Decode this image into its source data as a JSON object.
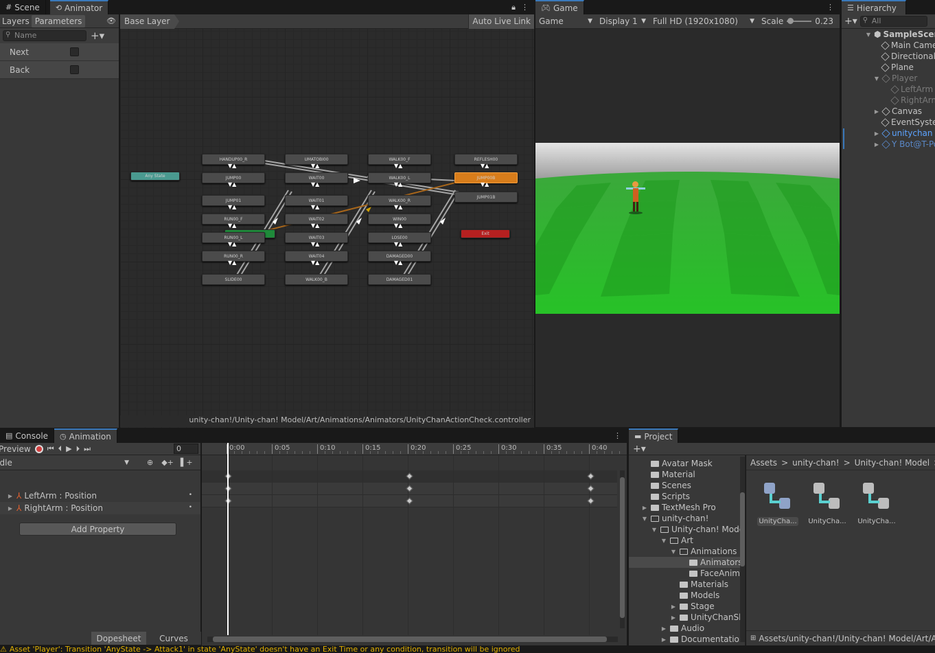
{
  "animator_tabs": {
    "scene": "Scene",
    "animator": "Animator"
  },
  "animator": {
    "layers_tab": "Layers",
    "parameters_tab": "Parameters",
    "search_placeholder": "Name",
    "params": [
      {
        "name": "Next"
      },
      {
        "name": "Back"
      }
    ],
    "breadcrumb": "Base Layer",
    "auto_live_link": "Auto Live Link",
    "path": "unity-chan!/Unity-chan! Model/Art/Animations/Animators/UnityChanActionCheck.controller",
    "any_state": "Any State",
    "exit": "Exit",
    "states": {
      "col1": [
        "HANDUP00_R",
        "JUMP00",
        "JUMP01",
        "RUN00_F",
        "RUN00_L",
        "RUN00_R",
        "SLIDE00"
      ],
      "col2": [
        "UMATOBI00",
        "WAIT00",
        "WAIT01",
        "WAIT02",
        "WAIT03",
        "WAIT04",
        "WALK00_B"
      ],
      "col3": [
        "WALK00_F",
        "WALK00_L",
        "WALK00_R",
        "WIN00",
        "LOSE00",
        "DAMAGED00",
        "DAMAGED01"
      ],
      "col4": [
        "REFLESH00",
        "JUMP00B",
        "JUMP01B"
      ]
    }
  },
  "game": {
    "tab": "Game",
    "mode": "Game",
    "display": "Display 1",
    "resolution": "Full HD (1920x1080)",
    "scale_label": "Scale",
    "scale_value": "0.23"
  },
  "hierarchy": {
    "tab": "Hierarchy",
    "search_placeholder": "All",
    "scene": "SampleScene",
    "items": [
      {
        "label": "Main Camera"
      },
      {
        "label": "Directional Light"
      },
      {
        "label": "Plane"
      },
      {
        "label": "Player"
      },
      {
        "label": "LeftArm"
      },
      {
        "label": "RightArm"
      },
      {
        "label": "Canvas"
      },
      {
        "label": "EventSystem"
      },
      {
        "label": "unitychan"
      },
      {
        "label": "Y Bot@T-Pose"
      }
    ]
  },
  "bottom_tabs": {
    "console": "Console",
    "animation": "Animation"
  },
  "animation": {
    "preview": "Preview",
    "frame": "0",
    "clip": "Idle",
    "properties": [
      {
        "label": "LeftArm : Position"
      },
      {
        "label": "RightArm : Position"
      }
    ],
    "add_property": "Add Property",
    "dopesheet": "Dopesheet",
    "curves": "Curves",
    "timeline": [
      "0:00",
      "0:05",
      "0:10",
      "0:15",
      "0:20",
      "0:25",
      "0:30",
      "0:35",
      "0:40"
    ]
  },
  "project": {
    "tab": "Project",
    "folders": [
      {
        "label": "Avatar Mask"
      },
      {
        "label": "Material"
      },
      {
        "label": "Scenes"
      },
      {
        "label": "Scripts"
      },
      {
        "label": "TextMesh Pro"
      },
      {
        "label": "unity-chan!"
      },
      {
        "label": "Unity-chan! Model"
      },
      {
        "label": "Art"
      },
      {
        "label": "Animations"
      },
      {
        "label": "Animators"
      },
      {
        "label": "FaceAnimation"
      },
      {
        "label": "Materials"
      },
      {
        "label": "Models"
      },
      {
        "label": "Stage"
      },
      {
        "label": "UnityChanShader"
      },
      {
        "label": "Audio"
      },
      {
        "label": "Documentation"
      }
    ],
    "breadcrumb": [
      "Assets",
      "unity-chan!",
      "Unity-chan! Model",
      "A"
    ],
    "assets": [
      {
        "label": "UnityCha..."
      },
      {
        "label": "UnityCha..."
      },
      {
        "label": "UnityCha..."
      }
    ],
    "footer_path": "Assets/unity-chan!/Unity-chan! Model/Art/An"
  },
  "status": {
    "message": "Asset 'Player': Transition 'AnyState -> Attack1' in state 'AnyState' doesn't have an Exit Time or any condition, transition will be ignored"
  },
  "colors": {
    "accent": "#3a79bb",
    "orange": "#d87d1b",
    "red": "#b52020",
    "teal": "#4a9a90",
    "green": "#2db52d"
  }
}
